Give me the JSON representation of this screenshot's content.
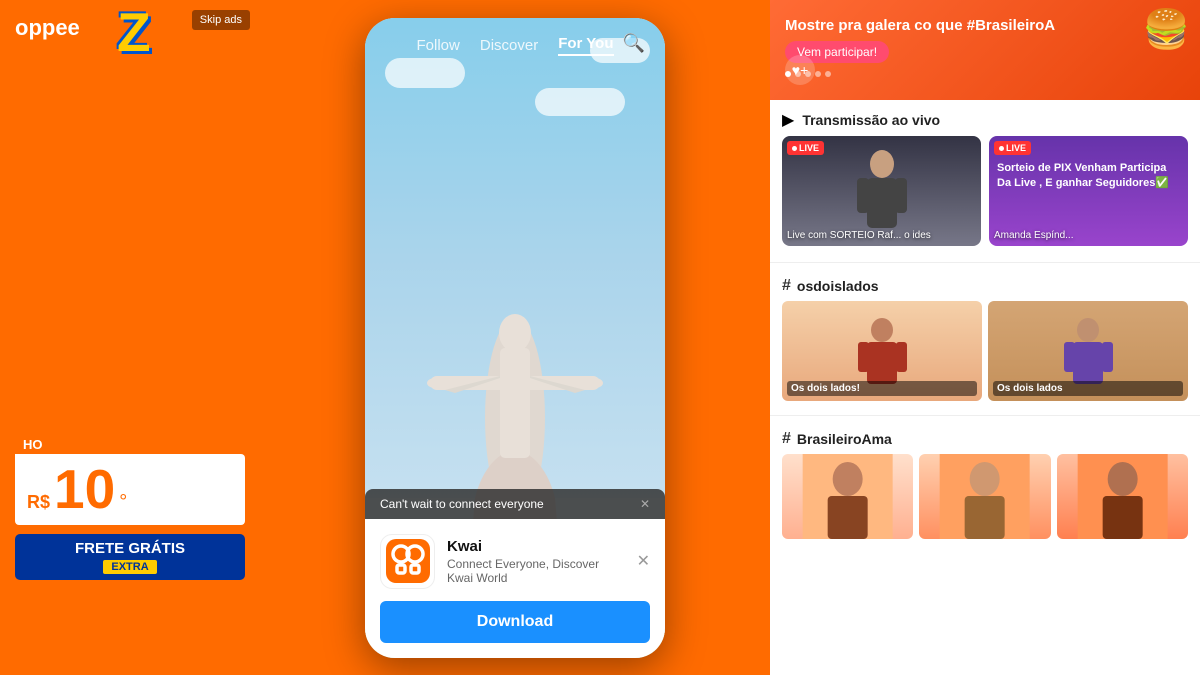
{
  "left_panel": {
    "logo": "oppee",
    "skip_ads": "Skip ads",
    "channel": "Z",
    "price_label": "HO",
    "price_prefix": "R$",
    "price_amount": "10",
    "free_shipping": "FRETE GRÁTIS",
    "extra_badge": "EXTRA"
  },
  "phone": {
    "nav": {
      "follow": "Follow",
      "discover": "Discover",
      "for_you": "For You"
    },
    "popup": {
      "header_text": "Can't wait to connect everyone",
      "app_name": "Kwai",
      "app_desc": "Connect Everyone, Discover Kwai World",
      "download_btn": "Download"
    }
  },
  "right_panel": {
    "banner": {
      "text": "Mostre pra galera co que #BrasileiroA",
      "cta": "Vem participar!",
      "heart": "♥"
    },
    "live_section": {
      "icon": "▶",
      "title": "Transmissão ao vivo",
      "cards": [
        {
          "badge": "LIVE",
          "label": "Live com SORTEIO Raf... o ides",
          "bg": "dark"
        },
        {
          "badge": "LIVE",
          "label": "Amanda Espínd...",
          "title_text": "Sorteio de PIX\nVenham Participa Da Live , E ganhar Seguidores✅",
          "bg": "purple"
        }
      ]
    },
    "hashtag1": {
      "symbol": "#",
      "name": "osdoislados",
      "videos": [
        {
          "label": "Os dois lados!",
          "bg": "warm1"
        },
        {
          "label": "Os dois lados",
          "bg": "warm2"
        }
      ]
    },
    "hashtag2": {
      "symbol": "#",
      "name": "BrasileiroAma",
      "videos": [
        {
          "label": "",
          "bg": "bra1"
        },
        {
          "label": "",
          "bg": "bra2"
        },
        {
          "label": "",
          "bg": "bra3"
        }
      ]
    }
  }
}
